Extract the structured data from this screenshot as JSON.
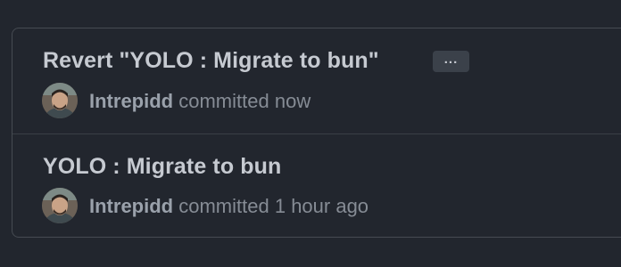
{
  "commits": [
    {
      "title": "Revert \"YOLO : Migrate to bun\"",
      "ellipsis_label": "...",
      "author": "Intrepidd",
      "action": "committed",
      "time": "now"
    },
    {
      "title": "YOLO : Migrate to bun",
      "author": "Intrepidd",
      "action": "committed",
      "time": "1 hour ago"
    }
  ]
}
